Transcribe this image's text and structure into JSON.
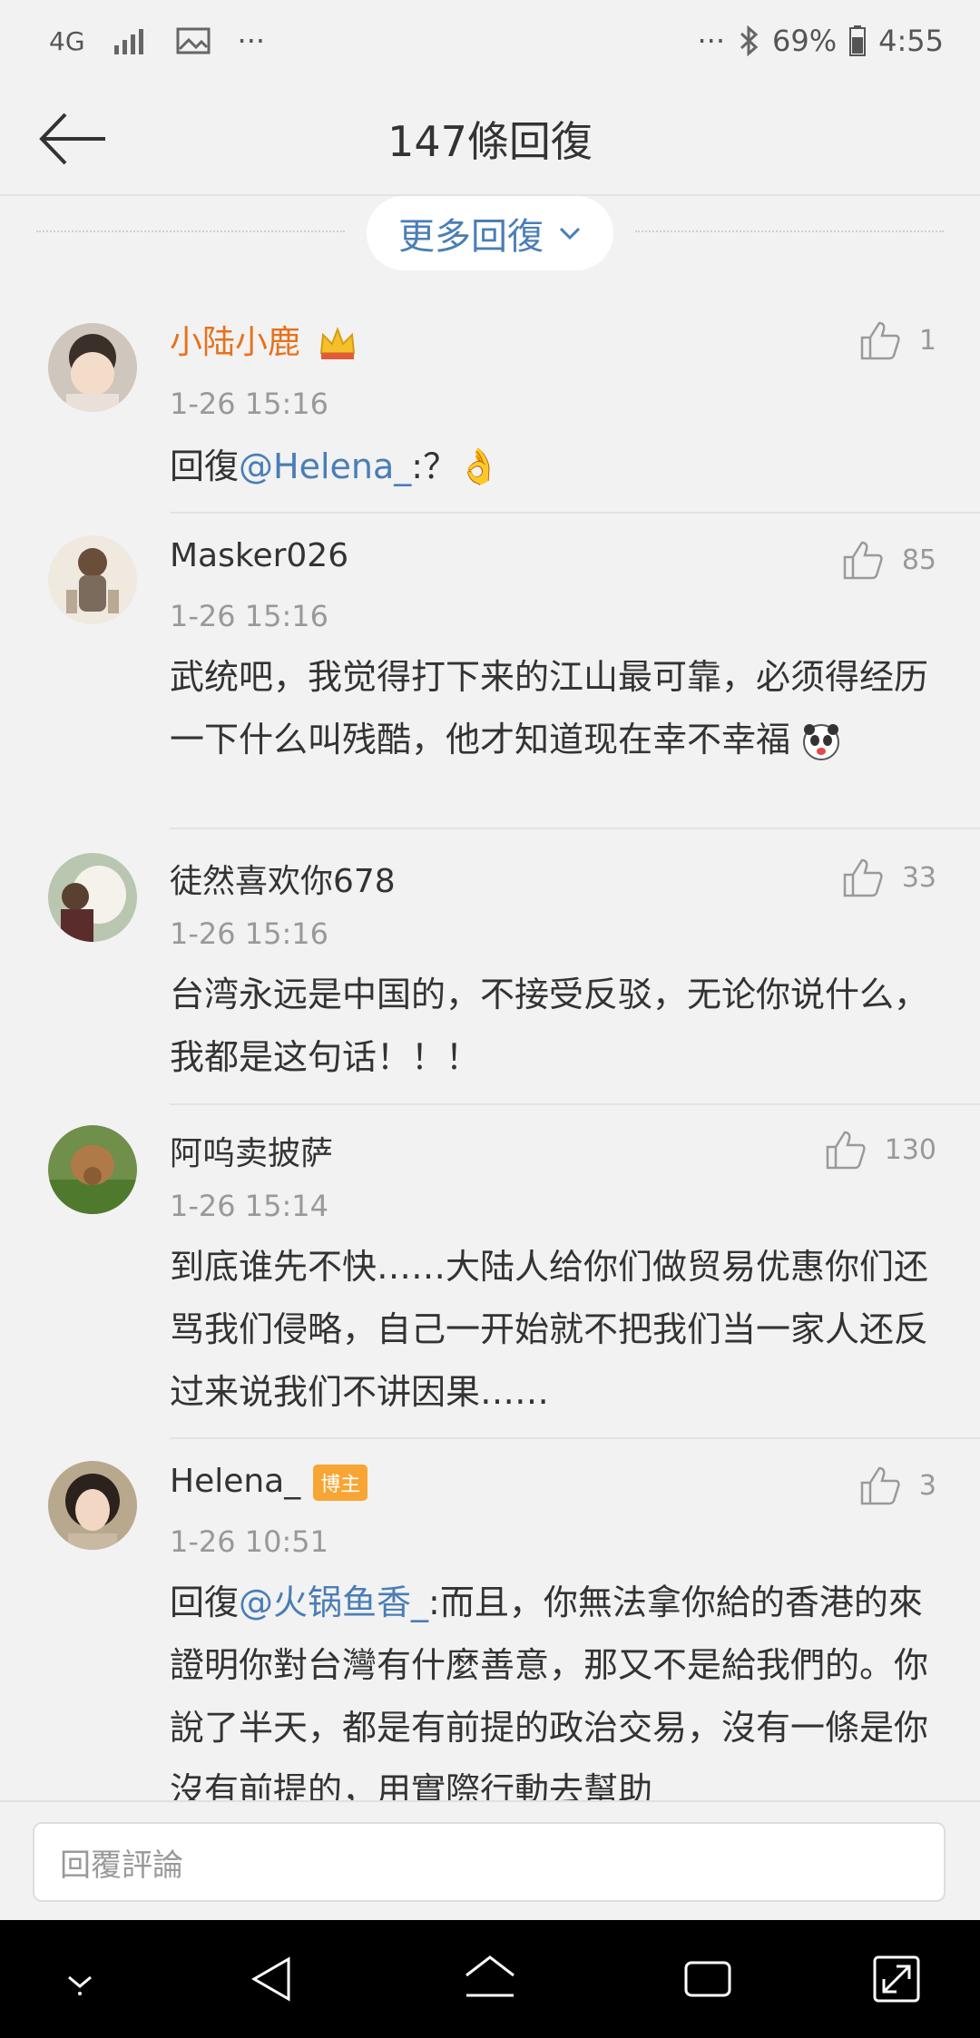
{
  "status_bar": {
    "network": "4G",
    "more_left": "···",
    "more_right": "···",
    "battery": "69%",
    "time": "4:55"
  },
  "header": {
    "title": "147條回復"
  },
  "more_replies": {
    "label": "更多回復"
  },
  "comments": [
    {
      "username": "小陆小鹿",
      "timestamp": "1-26 15:16",
      "likes": "1",
      "reply_prefix": "回復",
      "mention": "@Helena_",
      "text": ":？👌"
    },
    {
      "username": "Masker026",
      "timestamp": "1-26 15:16",
      "likes": "85",
      "text": "武统吧，我觉得打下来的江山最可靠，必须得经历一下什么叫残酷，他才知道现在幸不幸福"
    },
    {
      "username": "徒然喜欢你678",
      "timestamp": "1-26 15:16",
      "likes": "33",
      "text": "台湾永远是中国的，不接受反驳，无论你说什么，我都是这句话！！！"
    },
    {
      "username": "阿呜卖披萨",
      "timestamp": "1-26 15:14",
      "likes": "130",
      "text": "到底谁先不快……大陆人给你们做贸易优惠你们还骂我们侵略，自己一开始就不把我们当一家人还反过来说我们不讲因果……"
    },
    {
      "username": "Helena_",
      "badge": "博主",
      "timestamp": "1-26 10:51",
      "likes": "3",
      "reply_prefix": "回復",
      "mention": "@火锅鱼香_",
      "text": ":而且，你無法拿你給的香港的來證明你對台灣有什麼善意，那又不是給我們的。你說了半天，都是有前提的政治交易，沒有一條是你沒有前提的，用實際行動去幫助"
    }
  ],
  "input": {
    "placeholder": "回覆評論"
  },
  "colors": {
    "link": "#4a7eb5",
    "vip_name": "#e8711a",
    "badge": "#f7a534"
  }
}
